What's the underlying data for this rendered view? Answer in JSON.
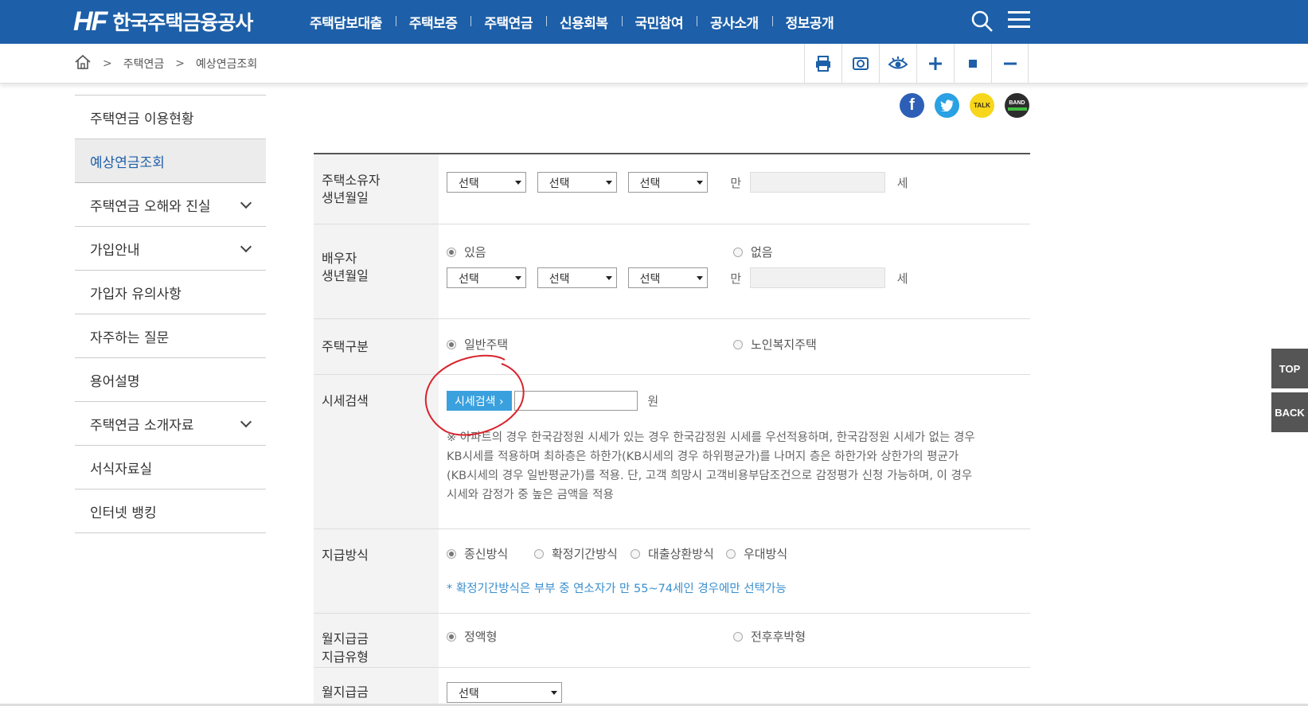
{
  "header": {
    "logo_mark": "HF",
    "logo_text": "한국주택금융공사",
    "nav": [
      "주택담보대출",
      "주택보증",
      "주택연금",
      "신용회복",
      "국민참여",
      "공사소개",
      "정보공개"
    ]
  },
  "breadcrumb": {
    "level1": "주택연금",
    "level2": "예상연금조회"
  },
  "sidebar": {
    "items": [
      {
        "label": "주택연금 이용현황"
      },
      {
        "label": "예상연금조회"
      },
      {
        "label": "주택연금 오해와 진실"
      },
      {
        "label": "가입안내"
      },
      {
        "label": "가입자 유의사항"
      },
      {
        "label": "자주하는 질문"
      },
      {
        "label": "용어설명"
      },
      {
        "label": "주택연금 소개자료"
      },
      {
        "label": "서식자료실"
      },
      {
        "label": "인터넷 뱅킹"
      }
    ]
  },
  "sns": {
    "talk": "TALK",
    "band": "BAND"
  },
  "form": {
    "owner": {
      "label_line1": "주택소유자",
      "label_line2": "생년월일",
      "sel1": "선택",
      "sel2": "선택",
      "sel3": "선택",
      "prefix": "만",
      "suffix": "세"
    },
    "spouse": {
      "label_line1": "배우자",
      "label_line2": "생년월일",
      "opt_yes": "있음",
      "opt_no": "없음",
      "sel1": "선택",
      "sel2": "선택",
      "sel3": "선택",
      "prefix": "만",
      "suffix": "세"
    },
    "house_type": {
      "label": "주택구분",
      "opt1": "일반주택",
      "opt2": "노인복지주택"
    },
    "price": {
      "label": "시세검색",
      "button": "시세검색",
      "unit": "원",
      "note": [
        "※ 아파트의 경우 한국감정원 시세가 있는 경우 한국감정원 시세를 우선적용하며, 한국감정원 시세가 없는 경우",
        "KB시세를 적용하며 최하층은 하한가(KB시세의 경우 하위평균가)를 나머지 층은 하한가와 상한가의 평균가",
        "(KB시세의 경우 일반평균가)를 적용. 단, 고객 희망시 고객비용부담조건으로 감정평가 신청 가능하며, 이 경우",
        "시세와 감정가 중 높은 금액을 적용"
      ]
    },
    "payment": {
      "label": "지급방식",
      "opt1": "종신방식",
      "opt2": "확정기간방식",
      "opt3": "대출상환방식",
      "opt4": "우대방식",
      "note": "* 확정기간방식은 부부 중 연소자가 만 55~74세인 경우에만 선택가능"
    },
    "monthly_type": {
      "label_line1": "월지급금",
      "label_line2": "지급유형",
      "opt1": "정액형",
      "opt2": "전후후박형"
    },
    "monthly": {
      "label": "월지급금",
      "sel": "선택"
    }
  },
  "quick": {
    "top": "TOP",
    "back": "BACK"
  },
  "colors": {
    "brand": "#1d5fa8",
    "button": "#3aa0de",
    "annotation": "#d9232d"
  }
}
